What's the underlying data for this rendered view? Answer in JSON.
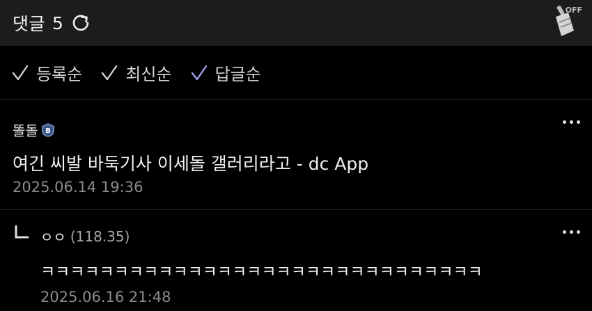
{
  "header": {
    "title": "댓글",
    "count": "5",
    "clean_badge": "OFF"
  },
  "sort": {
    "options": [
      {
        "label": "등록순"
      },
      {
        "label": "최신순"
      },
      {
        "label": "답글순"
      }
    ],
    "colors": {
      "default": "#d0d0d0",
      "selected": "#9fa0ec"
    }
  },
  "comments": [
    {
      "author": "똘돌",
      "text": "여긴 씨발 바둑기사 이세돌 갤러리라고 - dc App",
      "date": "2025.06.14 19:36"
    },
    {
      "author": "ㅇㅇ",
      "ip": "(118.35)",
      "text": "ㅋㅋㅋㅋㅋㅋㅋㅋㅋㅋㅋㅋㅋㅋㅋㅋㅋㅋㅋㅋㅋㅋㅋㅋㅋㅋㅋㅋㅋㅋ",
      "date": "2025.06.16 21:48"
    }
  ]
}
